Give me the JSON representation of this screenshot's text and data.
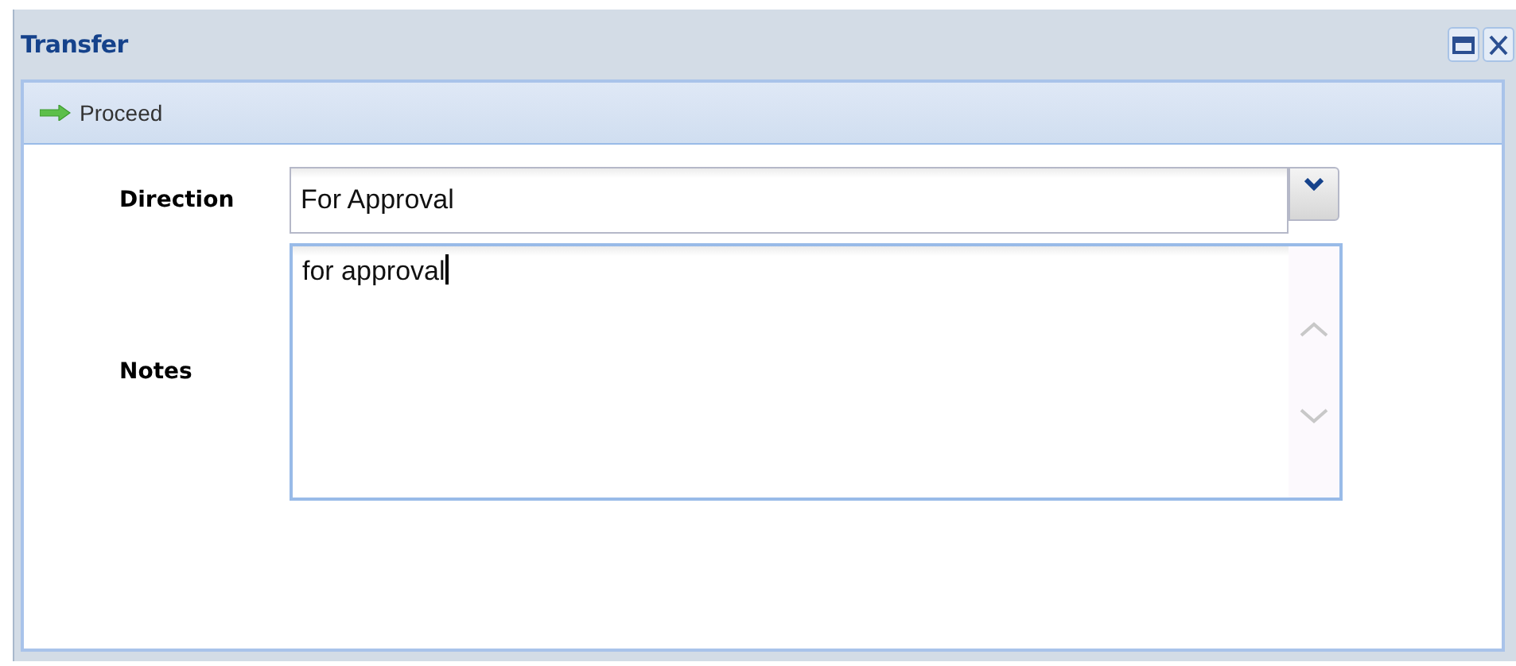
{
  "window": {
    "title": "Transfer"
  },
  "toolbar": {
    "buttons": [
      {
        "label": "Proceed"
      }
    ]
  },
  "form": {
    "fields": [
      {
        "kind": "combo",
        "label": "Direction",
        "value": "For Approval",
        "focused": false
      },
      {
        "kind": "textarea",
        "label": "Notes",
        "value": "for approval",
        "focused": true
      }
    ]
  }
}
